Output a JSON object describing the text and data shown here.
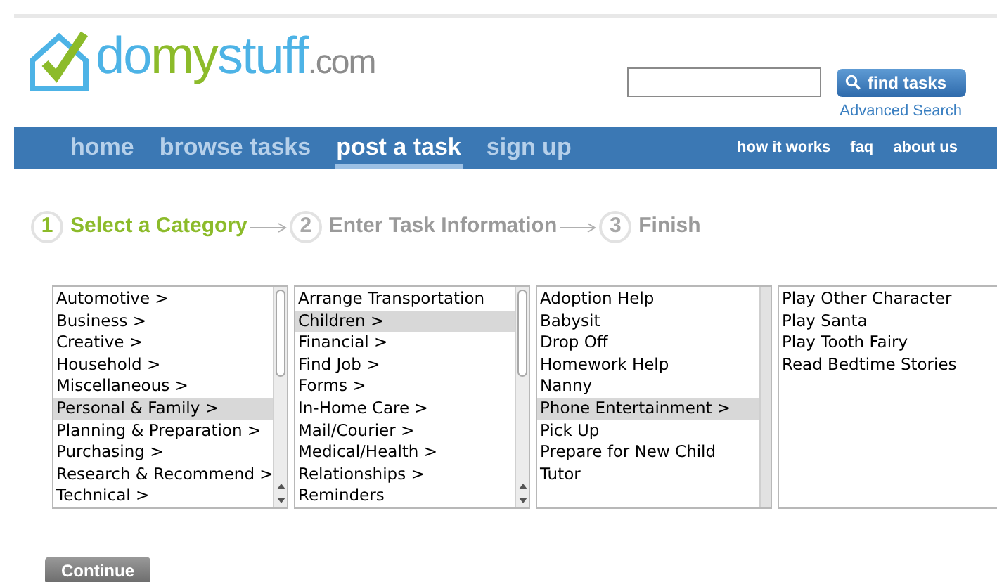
{
  "logo": {
    "parts": [
      {
        "text": "do",
        "color": "#4db3e6"
      },
      {
        "text": "my",
        "color": "#8cbb2a"
      },
      {
        "text": "stuff",
        "color": "#4db3e6"
      },
      {
        "text": ".com",
        "color": "#8c8c8c"
      }
    ]
  },
  "search": {
    "button": "find tasks",
    "link": "Advanced Search"
  },
  "nav": {
    "main": [
      {
        "label": "home",
        "selected": false
      },
      {
        "label": "browse tasks",
        "selected": false
      },
      {
        "label": "post a task",
        "selected": true
      },
      {
        "label": "sign up",
        "selected": false
      }
    ],
    "secondary": [
      "how it works",
      "faq",
      "about us"
    ]
  },
  "steps": [
    {
      "number": "1",
      "label": "Select a Category",
      "active": true
    },
    {
      "number": "2",
      "label": "Enter Task Information",
      "active": false
    },
    {
      "number": "3",
      "label": "Finish",
      "active": false
    }
  ],
  "lists": [
    {
      "kind": "scrolling",
      "items": [
        {
          "label": "Automotive >",
          "selected": false
        },
        {
          "label": "Business >",
          "selected": false
        },
        {
          "label": "Creative >",
          "selected": false
        },
        {
          "label": "Household >",
          "selected": false
        },
        {
          "label": "Miscellaneous >",
          "selected": false
        },
        {
          "label": "Personal & Family >",
          "selected": true
        },
        {
          "label": "Planning & Preparation >",
          "selected": false
        },
        {
          "label": "Purchasing >",
          "selected": false
        },
        {
          "label": "Research & Recommend >",
          "selected": false
        },
        {
          "label": "Technical >",
          "selected": false
        }
      ]
    },
    {
      "kind": "scrolling",
      "items": [
        {
          "label": "Arrange Transportation",
          "selected": false
        },
        {
          "label": "Children >",
          "selected": true
        },
        {
          "label": "Financial >",
          "selected": false
        },
        {
          "label": "Find Job >",
          "selected": false
        },
        {
          "label": "Forms >",
          "selected": false
        },
        {
          "label": "In-Home Care >",
          "selected": false
        },
        {
          "label": "Mail/Courier >",
          "selected": false
        },
        {
          "label": "Medical/Health >",
          "selected": false
        },
        {
          "label": "Relationships >",
          "selected": false
        },
        {
          "label": "Reminders",
          "selected": false
        }
      ]
    },
    {
      "kind": "track",
      "items": [
        {
          "label": "Adoption Help",
          "selected": false
        },
        {
          "label": "Babysit",
          "selected": false
        },
        {
          "label": "Drop Off",
          "selected": false
        },
        {
          "label": "Homework Help",
          "selected": false
        },
        {
          "label": "Nanny",
          "selected": false
        },
        {
          "label": "Phone Entertainment >",
          "selected": true
        },
        {
          "label": "Pick Up",
          "selected": false
        },
        {
          "label": "Prepare for New Child",
          "selected": false
        },
        {
          "label": "Tutor",
          "selected": false
        }
      ]
    },
    {
      "kind": "plain",
      "items": [
        {
          "label": "Play Other Character",
          "selected": false
        },
        {
          "label": "Play Santa",
          "selected": false
        },
        {
          "label": "Play Tooth Fairy",
          "selected": false
        },
        {
          "label": "Read Bedtime Stories",
          "selected": false
        }
      ]
    }
  ],
  "continue_button": "Continue"
}
